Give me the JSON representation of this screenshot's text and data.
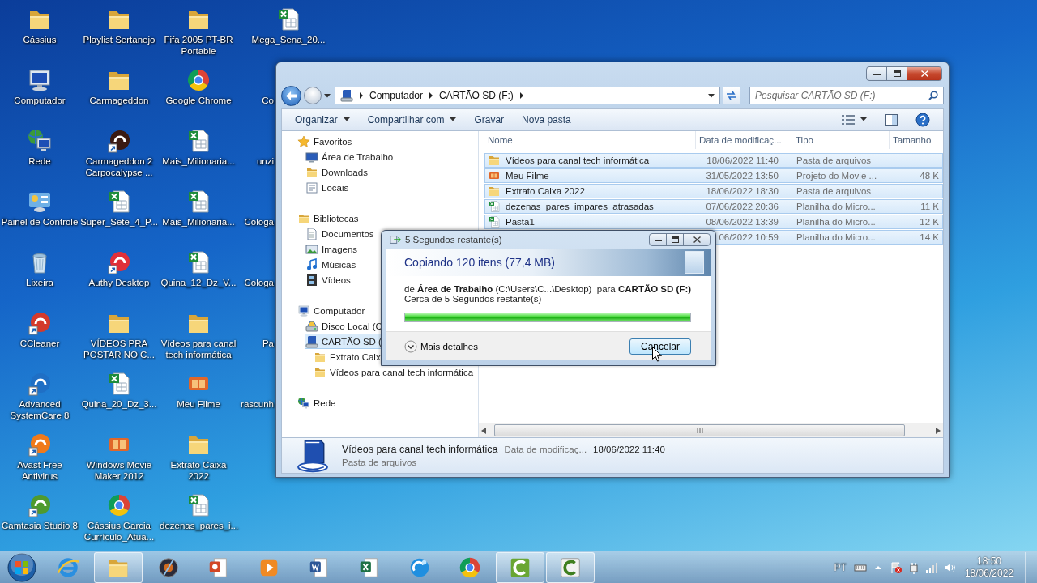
{
  "desktop": {
    "icons": [
      {
        "label": "Cássius",
        "kind": "folder"
      },
      {
        "label": "Computador",
        "kind": "computer"
      },
      {
        "label": "Rede",
        "kind": "network"
      },
      {
        "label": "Painel de Controle",
        "kind": "panel"
      },
      {
        "label": "Lixeira",
        "kind": "bin"
      },
      {
        "label": "CCleaner",
        "kind": "app",
        "color": "#d33a2c"
      },
      {
        "label": "Advanced SystemCare 8",
        "kind": "app",
        "color": "#1f6fc5"
      },
      {
        "label": "Avast Free Antivirus",
        "kind": "app",
        "color": "#f07a1a"
      },
      {
        "label": "Camtasia Studio 8",
        "kind": "app",
        "color": "#4f9a2e"
      },
      {
        "label": "Playlist Sertanejo",
        "kind": "folder"
      },
      {
        "label": "Carmageddon",
        "kind": "folder"
      },
      {
        "label": "Carmageddon 2 Carpocalypse ...",
        "kind": "app",
        "color": "#3a1a12"
      },
      {
        "label": "Super_Sete_4_P...",
        "kind": "sheet"
      },
      {
        "label": "Authy Desktop",
        "kind": "app",
        "color": "#e0303a"
      },
      {
        "label": "VÍDEOS PRA POSTAR NO C...",
        "kind": "folder"
      },
      {
        "label": "Quina_20_Dz_3...",
        "kind": "sheet"
      },
      {
        "label": "Windows Movie Maker 2012",
        "kind": "movie"
      },
      {
        "label": "Cássius Garcia Currículo_Atua...",
        "kind": "chrome"
      },
      {
        "label": "Fifa 2005 PT-BR Portable",
        "kind": "folder"
      },
      {
        "label": "Google Chrome",
        "kind": "chrome"
      },
      {
        "label": "Mais_Milionaria...",
        "kind": "sheet"
      },
      {
        "label": "Mais_Milionaria...",
        "kind": "sheet"
      },
      {
        "label": "Quina_12_Dz_V...",
        "kind": "sheet"
      },
      {
        "label": "Vídeos para canal tech informática",
        "kind": "folder"
      },
      {
        "label": "Meu Filme",
        "kind": "movie"
      },
      {
        "label": "Extrato Caixa 2022",
        "kind": "folder"
      },
      {
        "label": "dezenas_pares_i...",
        "kind": "sheet"
      },
      {
        "label": "Mega_Sena_20...",
        "kind": "sheet"
      },
      {
        "label": "Co"
      },
      {
        "label": "unzi"
      },
      {
        "label": "Cologa"
      },
      {
        "label": "Cologa"
      },
      {
        "label": "Pa"
      },
      {
        "label": "rascunh"
      }
    ]
  },
  "explorer": {
    "address": {
      "crumbs": [
        "Computador",
        "CARTÃO SD (F:)"
      ]
    },
    "search": {
      "placeholder": "Pesquisar CARTÃO SD (F:)"
    },
    "toolbar": [
      {
        "label": "Organizar",
        "dropdown": true
      },
      {
        "label": "Compartilhar com",
        "dropdown": true
      },
      {
        "label": "Gravar",
        "dropdown": false
      },
      {
        "label": "Nova pasta",
        "dropdown": false
      }
    ],
    "nav": [
      {
        "label": "Favoritos",
        "kind": "star",
        "selected": false,
        "children": [
          {
            "label": "Área de Trabalho",
            "kind": "desktop",
            "selected": false
          },
          {
            "label": "Downloads",
            "kind": "folder",
            "selected": false
          },
          {
            "label": "Locais",
            "kind": "places",
            "selected": false
          }
        ]
      },
      {
        "label": "Bibliotecas",
        "kind": "folder",
        "selected": false,
        "children": [
          {
            "label": "Documentos",
            "kind": "document",
            "selected": false
          },
          {
            "label": "Imagens",
            "kind": "image",
            "selected": false
          },
          {
            "label": "Músicas",
            "kind": "music",
            "selected": false
          },
          {
            "label": "Vídeos",
            "kind": "video",
            "selected": false
          }
        ]
      },
      {
        "label": "Computador",
        "kind": "computer",
        "selected": false,
        "children": [
          {
            "label": "Disco Local (C",
            "kind": "disk",
            "selected": false
          },
          {
            "label": "CARTÃO SD (",
            "kind": "sd",
            "selected": true,
            "children": [
              {
                "label": "Extrato Caix",
                "kind": "folder",
                "selected": false
              },
              {
                "label": "Vídeos para canal tech informática",
                "kind": "folder",
                "selected": false
              }
            ]
          }
        ]
      },
      {
        "label": "Rede",
        "kind": "network",
        "selected": false
      }
    ],
    "columns": [
      "Nome",
      "Data de modificaç...",
      "Tipo",
      "Tamanho"
    ],
    "rows": [
      {
        "kind": "folder",
        "name": "Vídeos para canal tech informática",
        "date": "18/06/2022 11:40",
        "type": "Pasta de arquivos",
        "selected": true
      },
      {
        "kind": "movie",
        "name": "Meu Filme",
        "date": "31/05/2022 13:50",
        "type": "Projeto do Movie ...",
        "size": "48 K",
        "selected": true
      },
      {
        "kind": "folder",
        "name": "Extrato Caixa 2022",
        "date": "18/06/2022 18:30",
        "type": "Pasta de arquivos",
        "selected": true
      },
      {
        "kind": "sheet",
        "name": "dezenas_pares_impares_atrasadas",
        "date": "07/06/2022 20:36",
        "type": "Planilha do Micro...",
        "size": "11 K",
        "selected": true
      },
      {
        "kind": "sheet",
        "name": "Pasta1",
        "date": "08/06/2022 13:39",
        "type": "Planilha do Micro...",
        "size": "12 K",
        "selected": true
      },
      {
        "date": "06/2022 10:59",
        "type": "Planilha do Micro...",
        "size": "14 K",
        "selected": true
      }
    ],
    "details": {
      "name": "Vídeos para canal tech informática",
      "date_label": "Data de modificaç...",
      "date": "18/06/2022 11:40",
      "type": "Pasta de arquivos"
    }
  },
  "copy_dialog": {
    "title": "5 Segundos restante(s)",
    "heading": "Copiando 120 itens (77,4 MB)",
    "route": "de **Área de Trabalho** (C:\\Users\\C...\\Desktop)  para **CARTÃO SD (F:)**",
    "remaining": "Cerca de 5 Segundos restante(s)",
    "level": 1,
    "details_button": "Mais detalhes",
    "cancel_button": "Cancelar"
  },
  "taskbar": {
    "apps": [
      {
        "kind": "browser",
        "open": false
      },
      {
        "kind": "folder",
        "open": true
      },
      {
        "kind": "media-center",
        "open": false
      },
      {
        "kind": "slides",
        "open": false
      },
      {
        "kind": "player",
        "open": false
      },
      {
        "kind": "word",
        "open": false
      },
      {
        "kind": "excel",
        "open": false
      },
      {
        "kind": "chat",
        "open": false
      },
      {
        "kind": "chrome",
        "open": false
      },
      {
        "kind": "recorder",
        "open": true
      },
      {
        "kind": "recorder-light",
        "open": true
      }
    ],
    "language": "PT",
    "time": "18:50",
    "date": "18/06/2022"
  }
}
